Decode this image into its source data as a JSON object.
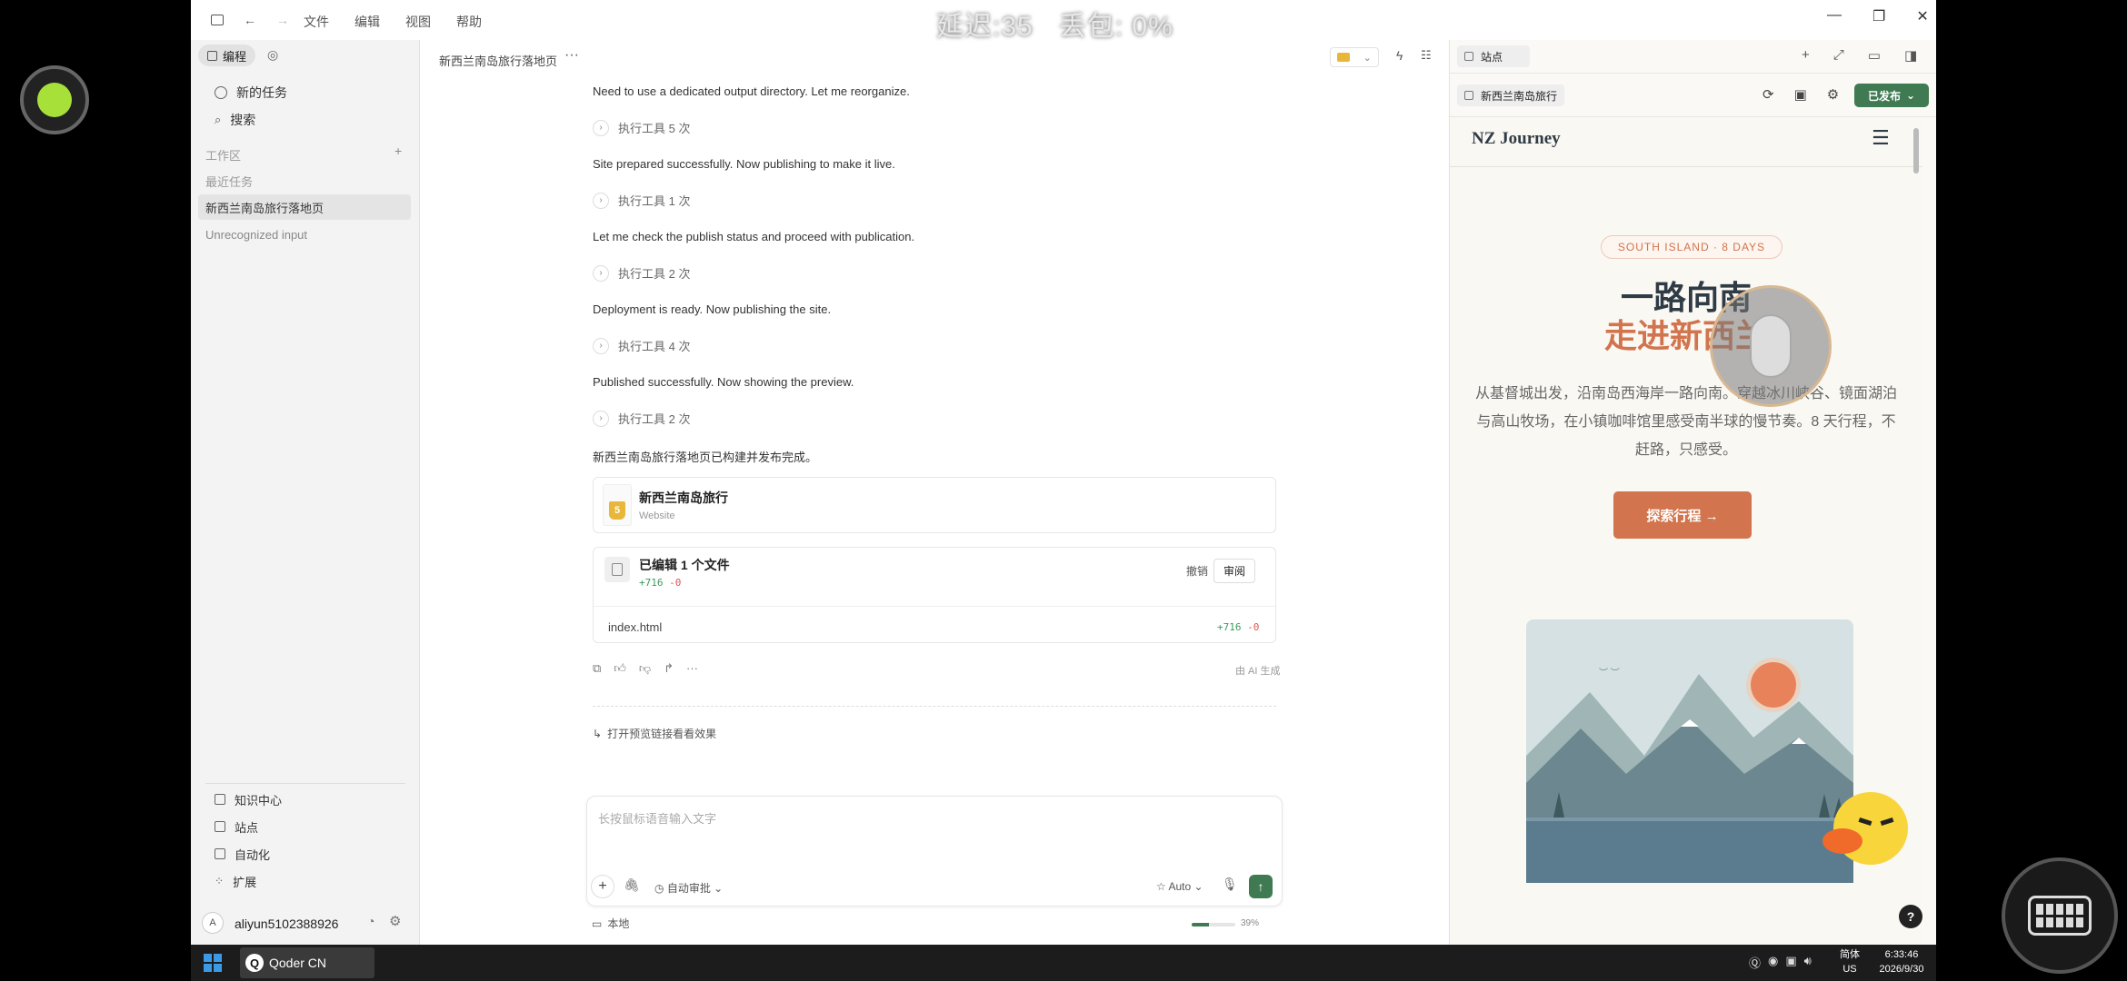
{
  "overlay": {
    "latency": "延迟:35",
    "packet_loss": "丢包: 0%"
  },
  "menu": [
    "文件",
    "编辑",
    "视图",
    "帮助"
  ],
  "sidebar": {
    "mode_tab": "编程",
    "new_task": "新的任务",
    "search": "搜索",
    "workspace_label": "工作区",
    "recent_label": "最近任务",
    "recent_items": [
      "新西兰南岛旅行落地页",
      "Unrecognized input"
    ],
    "bottom_items": [
      "知识中心",
      "站点",
      "自动化",
      "扩展"
    ],
    "avatar_letter": "A",
    "username": "aliyun5102388926"
  },
  "chat": {
    "title": "新西兰南岛旅行落地页",
    "messages": [
      {
        "text": "Need to use a dedicated output directory. Let me reorganize.",
        "tool": "执行工具 5 次"
      },
      {
        "text": "Site prepared successfully. Now publishing to make it live.",
        "tool": "执行工具 1 次"
      },
      {
        "text": "Let me check the publish status and proceed with publication.",
        "tool": "执行工具 2 次"
      },
      {
        "text": "Deployment is ready. Now publishing the site.",
        "tool": "执行工具 4 次"
      },
      {
        "text": "Published successfully. Now showing the preview.",
        "tool": "执行工具 2 次"
      }
    ],
    "final_message": "新西兰南岛旅行落地页已构建并发布完成。",
    "site_card": {
      "title": "新西兰南岛旅行",
      "subtitle": "Website"
    },
    "edit_card": {
      "title": "已编辑 1 个文件",
      "additions": "+716",
      "deletions": "-0",
      "undo": "撤销",
      "review": "审阅",
      "file": "index.html"
    },
    "ai_generated": "由 AI 生成",
    "open_preview": "打开预览链接看看效果",
    "input_placeholder": "长按鼠标语音输入文字",
    "auto_approve": "自动审批",
    "model": "Auto",
    "local": "本地",
    "progress_label": "39%",
    "progress": 0.39
  },
  "panel": {
    "tab": "站点",
    "site_chip": "新西兰南岛旅行",
    "publish_button": "已发布"
  },
  "preview": {
    "brand": "NZ Journey",
    "badge": "SOUTH ISLAND · 8 DAYS",
    "headline_1": "一路向南",
    "headline_2": "走进新西兰",
    "description": "从基督城出发，沿南岛西海岸一路向南。穿越冰川峡谷、镜面湖泊与高山牧场，在小镇咖啡馆里感受南半球的慢节奏。8 天行程，不赶路，只感受。",
    "cta": "探索行程 →",
    "colors": {
      "accent": "#d2744d",
      "dark": "#2f3b45"
    }
  },
  "taskbar": {
    "app": "Qoder CN",
    "ime_1": "简体",
    "ime_2": "US",
    "time": "6:33:46",
    "date": "2026/9/30"
  }
}
